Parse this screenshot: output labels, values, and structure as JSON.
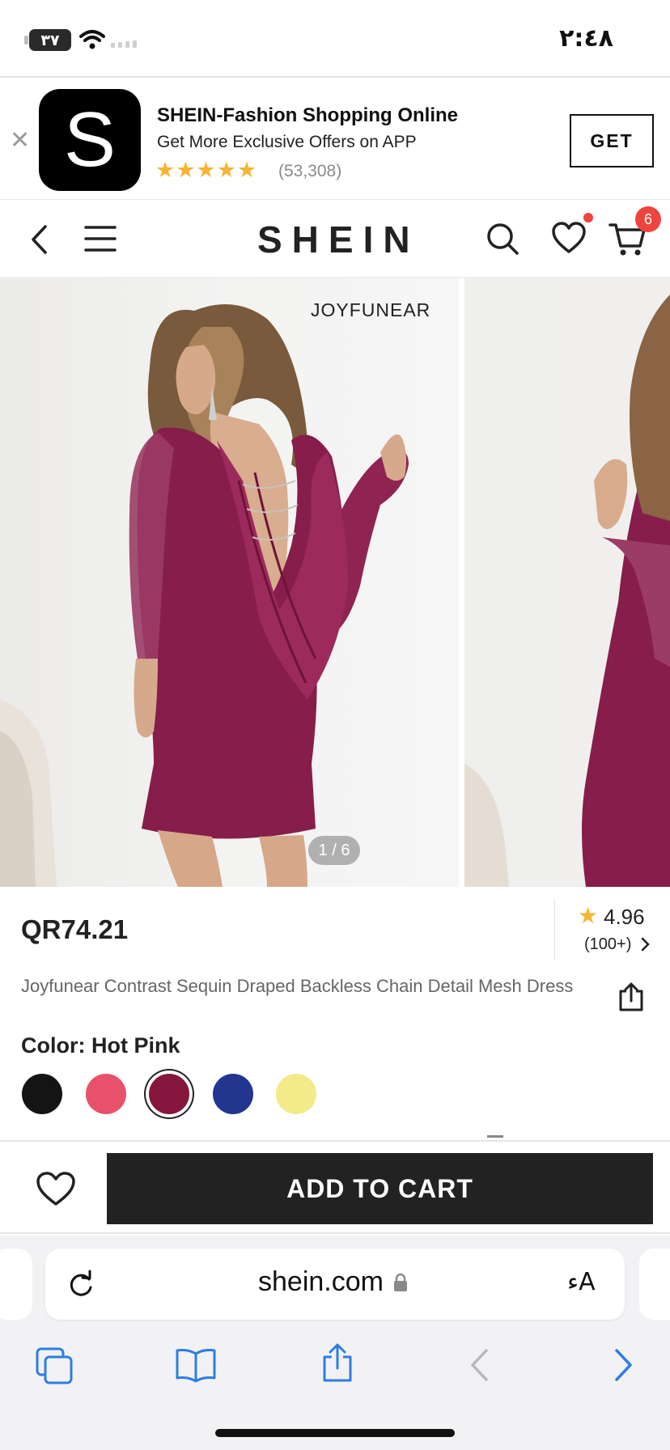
{
  "status_bar": {
    "battery": "٣٧",
    "time": "٢:٤٨"
  },
  "app_banner": {
    "logo_letter": "S",
    "title": "SHEIN-Fashion Shopping Online",
    "subtitle": "Get More Exclusive Offers on APP",
    "stars": "★★★★★",
    "reviews": "(53,308)",
    "get_label": "GET"
  },
  "nav": {
    "brand": "SHEIN",
    "cart_count": "6"
  },
  "gallery": {
    "photo_brand": "JOYFUNEAR",
    "counter": "1 / 6"
  },
  "product": {
    "price": "QR74.21",
    "rating_star": "★",
    "rating": "4.96",
    "rating_count": "(100+)",
    "title": "Joyfunear Contrast Sequin Draped Backless Chain Detail Mesh Dress",
    "color_label": "Color: Hot Pink",
    "swatches": [
      {
        "color": "#141414",
        "selected": false
      },
      {
        "color": "#e8516b",
        "selected": false
      },
      {
        "color": "#85163d",
        "selected": true
      },
      {
        "color": "#22358f",
        "selected": false
      },
      {
        "color": "#f3ea89",
        "selected": false
      }
    ]
  },
  "actions": {
    "add_to_cart": "ADD TO CART"
  },
  "browser": {
    "url": "shein.com",
    "text_size": "ءA"
  },
  "colors": {
    "accent_red": "#f0443e",
    "star_yellow": "#f6b434",
    "ios_blue": "#2f7de1",
    "dress": "#861d4b"
  }
}
